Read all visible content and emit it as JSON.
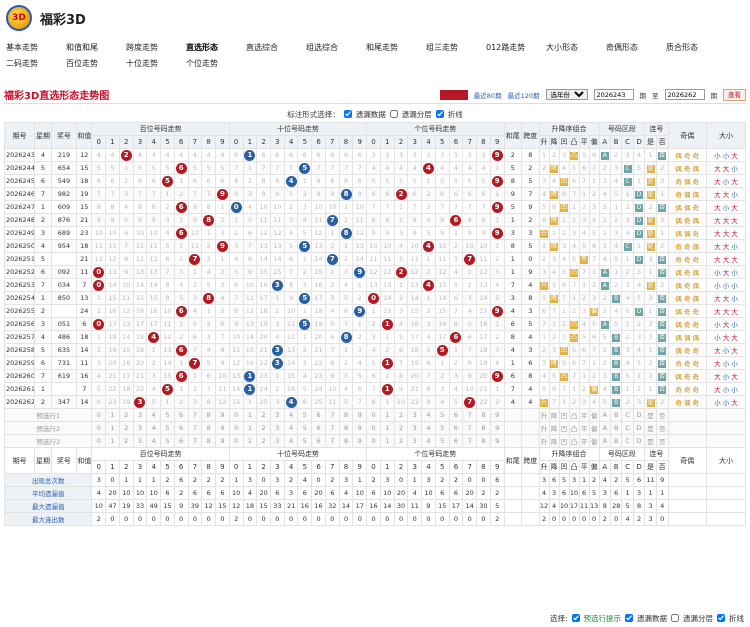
{
  "brand": {
    "name": "福彩3D",
    "logo_text": "3D"
  },
  "nav": [
    "基本走势",
    "和值和尾",
    "跨度走势",
    "直选形态",
    "直选综合",
    "组选综合",
    "和尾走势",
    "组三走势",
    "012路走势",
    "大小形态",
    "奇偶形态",
    "质合形态",
    "二码走势",
    "百位走势",
    "十位走势",
    "个位走势"
  ],
  "nav_active": 3,
  "page": {
    "title": "福彩3D直选形态走势图",
    "recent50": "最近50期",
    "recent80": "最近80期",
    "recent120": "最近120期",
    "select_value": "选年份",
    "from_value": "2026243",
    "period1": "期",
    "to_label": "至",
    "to_value": "2026262",
    "period2": "期",
    "query": "查看"
  },
  "options": {
    "label": "标注形式选择：",
    "o1": "遗漏数据",
    "o2": "遗漏分层",
    "o3": "折线"
  },
  "head": {
    "issue": "期号",
    "week": "星期",
    "prize": "奖号",
    "sum": "和值",
    "hund": "百位号码走势",
    "ten": "十位号码走势",
    "unit": "个位号码走势",
    "sumtail": "和尾",
    "span": "跨度",
    "order": "升降序组合",
    "zone": "号码区段",
    "cont": "连号",
    "oddeven": "奇偶",
    "size": "大小",
    "order_sub": [
      "升",
      "降",
      "凹",
      "凸",
      "平",
      "偏"
    ],
    "zone_sub": [
      "A",
      "B",
      "C",
      "D"
    ],
    "cont_sub": [
      "是",
      "否"
    ]
  },
  "digits": [
    "0",
    "1",
    "2",
    "3",
    "4",
    "5",
    "6",
    "7",
    "8",
    "9"
  ],
  "rows": [
    {
      "i": "2026243",
      "w": "4",
      "p": "219",
      "s": "12",
      "h": "2",
      "t": "1",
      "u": "9",
      "tail": "2",
      "span": "8",
      "ord": "凸",
      "zone": "A",
      "cont": "否",
      "oe": [
        "偶",
        "奇",
        "奇"
      ],
      "sz": [
        "小",
        "小",
        "大"
      ]
    },
    {
      "i": "2026244",
      "w": "5",
      "p": "654",
      "s": "15",
      "h": "6",
      "t": "5",
      "u": "4",
      "tail": "5",
      "span": "2",
      "ord": "降",
      "zone": "C",
      "cont": "是",
      "oe": [
        "偶",
        "奇",
        "偶"
      ],
      "sz": [
        "大",
        "大",
        "小"
      ]
    },
    {
      "i": "2026245",
      "w": "6",
      "p": "549",
      "s": "18",
      "h": "5",
      "t": "4",
      "u": "9",
      "tail": "8",
      "span": "5",
      "ord": "凹",
      "zone": "C",
      "cont": "是",
      "oe": [
        "奇",
        "偶",
        "奇"
      ],
      "sz": [
        "大",
        "小",
        "大"
      ]
    },
    {
      "i": "2026246",
      "w": "7",
      "p": "982",
      "s": "19",
      "h": "9",
      "t": "8",
      "u": "2",
      "tail": "9",
      "span": "7",
      "ord": "降",
      "zone": "D",
      "cont": "是",
      "oe": [
        "奇",
        "偶",
        "偶"
      ],
      "sz": [
        "大",
        "大",
        "小"
      ]
    },
    {
      "i": "2026247",
      "w": "1",
      "p": "609",
      "s": "15",
      "h": "6",
      "t": "0",
      "u": "9",
      "tail": "5",
      "span": "9",
      "ord": "凹",
      "zone": "D",
      "cont": "否",
      "oe": [
        "偶",
        "偶",
        "奇"
      ],
      "sz": [
        "大",
        "小",
        "大"
      ]
    },
    {
      "i": "2026248",
      "w": "2",
      "p": "876",
      "s": "21",
      "h": "8",
      "t": "7",
      "u": "6",
      "tail": "1",
      "span": "2",
      "ord": "降",
      "zone": "D",
      "cont": "是",
      "oe": [
        "偶",
        "奇",
        "偶"
      ],
      "sz": [
        "大",
        "大",
        "大"
      ]
    },
    {
      "i": "2026249",
      "w": "3",
      "p": "689",
      "s": "23",
      "h": "6",
      "t": "8",
      "u": "9",
      "tail": "3",
      "span": "3",
      "ord": "升",
      "zone": "D",
      "cont": "是",
      "oe": [
        "偶",
        "偶",
        "奇"
      ],
      "sz": [
        "大",
        "大",
        "大"
      ]
    },
    {
      "i": "2026250",
      "w": "4",
      "p": "954",
      "s": "18",
      "h": "9",
      "t": "5",
      "u": "4",
      "tail": "8",
      "span": "5",
      "ord": "降",
      "zone": "C",
      "cont": "是",
      "oe": [
        "奇",
        "奇",
        "偶"
      ],
      "sz": [
        "大",
        "大",
        "小"
      ]
    },
    {
      "i": "2026251",
      "w": "5",
      "p": "777",
      "s": "21",
      "h": "7",
      "t": "7",
      "u": "7",
      "tail": "1",
      "span": "0",
      "ord": "平",
      "zone": "D",
      "cont": "否",
      "oe": [
        "奇",
        "奇",
        "奇"
      ],
      "sz": [
        "大",
        "大",
        "大"
      ],
      "hl": true
    },
    {
      "i": "2026252",
      "w": "6",
      "p": "092",
      "s": "11",
      "h": "0",
      "t": "9",
      "u": "2",
      "tail": "1",
      "span": "9",
      "ord": "凸",
      "zone": "A",
      "cont": "否",
      "oe": [
        "偶",
        "奇",
        "偶"
      ],
      "sz": [
        "小",
        "大",
        "小"
      ]
    },
    {
      "i": "2026253",
      "w": "7",
      "p": "034",
      "s": "7",
      "h": "0",
      "t": "3",
      "u": "4",
      "tail": "7",
      "span": "4",
      "ord": "升",
      "zone": "A",
      "cont": "是",
      "oe": [
        "偶",
        "奇",
        "偶"
      ],
      "sz": [
        "小",
        "小",
        "小"
      ]
    },
    {
      "i": "2026254",
      "w": "1",
      "p": "850",
      "s": "13",
      "h": "8",
      "t": "5",
      "u": "0",
      "tail": "3",
      "span": "8",
      "ord": "降",
      "zone": "B",
      "cont": "否",
      "oe": [
        "偶",
        "奇",
        "偶"
      ],
      "sz": [
        "大",
        "大",
        "小"
      ]
    },
    {
      "i": "2026255",
      "w": "2",
      "p": "699",
      "s": "24",
      "h": "6",
      "t": "9",
      "u": "9",
      "tail": "4",
      "span": "3",
      "ord": "偏",
      "zone": "D",
      "cont": "否",
      "oe": [
        "偶",
        "奇",
        "奇"
      ],
      "sz": [
        "大",
        "大",
        "大"
      ],
      "hl": true
    },
    {
      "i": "2026256",
      "w": "3",
      "p": "051",
      "s": "6",
      "h": "0",
      "t": "5",
      "u": "1",
      "tail": "6",
      "span": "5",
      "ord": "凸",
      "zone": "A",
      "cont": "否",
      "oe": [
        "偶",
        "奇",
        "奇"
      ],
      "sz": [
        "小",
        "大",
        "小"
      ]
    },
    {
      "i": "2026257",
      "w": "4",
      "p": "486",
      "s": "18",
      "h": "4",
      "t": "8",
      "u": "6",
      "tail": "8",
      "span": "4",
      "ord": "凸",
      "zone": "B",
      "cont": "否",
      "oe": [
        "偶",
        "偶",
        "偶"
      ],
      "sz": [
        "小",
        "大",
        "大"
      ]
    },
    {
      "i": "2026258",
      "w": "5",
      "p": "635",
      "s": "14",
      "h": "6",
      "t": "3",
      "u": "5",
      "tail": "4",
      "span": "3",
      "ord": "凹",
      "zone": "B",
      "cont": "否",
      "oe": [
        "偶",
        "奇",
        "奇"
      ],
      "sz": [
        "大",
        "小",
        "大"
      ]
    },
    {
      "i": "2026259",
      "w": "6",
      "p": "731",
      "s": "11",
      "h": "7",
      "t": "3",
      "u": "1",
      "tail": "1",
      "span": "6",
      "ord": "降",
      "zone": "B",
      "cont": "否",
      "oe": [
        "奇",
        "奇",
        "奇"
      ],
      "sz": [
        "大",
        "小",
        "小"
      ]
    },
    {
      "i": "2026260",
      "w": "7",
      "p": "619",
      "s": "16",
      "h": "6",
      "t": "1",
      "u": "9",
      "tail": "6",
      "span": "8",
      "ord": "凹",
      "zone": "B",
      "cont": "否",
      "oe": [
        "偶",
        "奇",
        "奇"
      ],
      "sz": [
        "大",
        "小",
        "大"
      ]
    },
    {
      "i": "2026261",
      "w": "1",
      "p": "511",
      "s": "7",
      "h": "5",
      "t": "1",
      "u": "1",
      "tail": "7",
      "span": "4",
      "ord": "偏",
      "zone": "B",
      "cont": "否",
      "oe": [
        "奇",
        "奇",
        "奇"
      ],
      "sz": [
        "大",
        "小",
        "小"
      ],
      "hl": true
    },
    {
      "i": "2026262",
      "w": "2",
      "p": "347",
      "s": "14",
      "h": "3",
      "t": "4",
      "u": "7",
      "tail": "4",
      "span": "4",
      "ord": "升",
      "zone": "B",
      "cont": "是",
      "oe": [
        "奇",
        "偶",
        "奇"
      ],
      "sz": [
        "小",
        "小",
        "大"
      ]
    }
  ],
  "pre": [
    "预选行1",
    "预选行2",
    "预选行3"
  ],
  "stats": [
    {
      "label": "出现总次数",
      "vals": [
        "3",
        "0",
        "1",
        "1",
        "1",
        "2",
        "6",
        "2",
        "2",
        "2",
        "1",
        "3",
        "0",
        "3",
        "2",
        "4",
        "0",
        "2",
        "3",
        "1",
        "2",
        "3",
        "0",
        "1",
        "3",
        "2",
        "2",
        "0",
        "0",
        "6"
      ],
      "ord": [
        "3",
        "6",
        "5",
        "3",
        "1",
        "2"
      ],
      "zone": [
        "4",
        "2",
        "5",
        "6"
      ],
      "cont": [
        "11",
        "9"
      ]
    },
    {
      "label": "平均遗漏值",
      "vals": [
        "4",
        "20",
        "10",
        "10",
        "10",
        "6",
        "2",
        "6",
        "6",
        "6",
        "10",
        "4",
        "20",
        "6",
        "3",
        "6",
        "20",
        "6",
        "4",
        "10",
        "6",
        "10",
        "20",
        "4",
        "10",
        "6",
        "6",
        "20",
        "2",
        "2"
      ],
      "ord": [
        "4",
        "3",
        "6",
        "10",
        "6",
        "5"
      ],
      "zone": [
        "3",
        "6",
        "1",
        "3"
      ],
      "cont": [
        "1",
        "1"
      ]
    },
    {
      "label": "最大遗漏值",
      "vals": [
        "10",
        "47",
        "19",
        "33",
        "49",
        "15",
        "9",
        "39",
        "12",
        "15",
        "12",
        "18",
        "15",
        "33",
        "21",
        "16",
        "16",
        "32",
        "14",
        "17",
        "16",
        "14",
        "30",
        "11",
        "9",
        "15",
        "17",
        "14",
        "30",
        "5"
      ],
      "ord": [
        "12",
        "4",
        "10",
        "17",
        "11",
        "13"
      ],
      "zone": [
        "8",
        "28",
        "5",
        "8"
      ],
      "cont": [
        "3",
        "4"
      ]
    },
    {
      "label": "最大连出数",
      "vals": [
        "2",
        "0",
        "0",
        "0",
        "0",
        "0",
        "0",
        "0",
        "0",
        "0",
        "2",
        "0",
        "0",
        "0",
        "0",
        "0",
        "0",
        "0",
        "0",
        "0",
        "0",
        "0",
        "0",
        "0",
        "0",
        "0",
        "0",
        "0",
        "0",
        "2"
      ],
      "ord": [
        "2",
        "0",
        "0",
        "0",
        "0",
        "0"
      ],
      "zone": [
        "2",
        "0",
        "4",
        "2"
      ],
      "cont": [
        "3",
        "0"
      ]
    }
  ],
  "bottom": {
    "label": "选择:",
    "b1": "预选行提示",
    "b2": "遗漏数据",
    "b3": "遗漏分层",
    "b4": "折线"
  }
}
